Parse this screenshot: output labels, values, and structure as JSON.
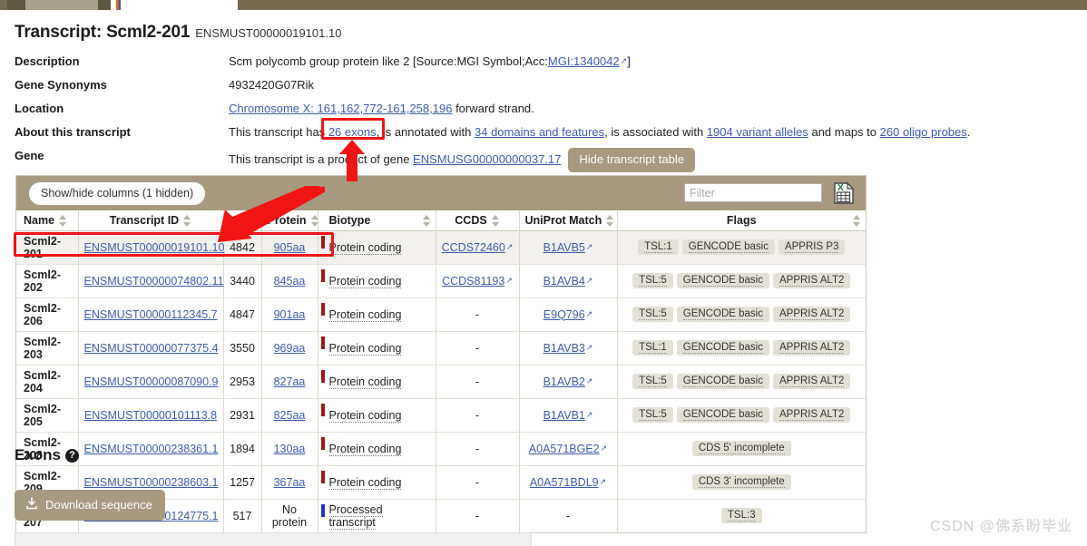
{
  "page": {
    "title_prefix": "Transcript: Scml2-201",
    "accession": "ENSMUST00000019101.10"
  },
  "summary": {
    "rows": [
      {
        "label": "Description",
        "value": "Scm polycomb group protein like 2 [Source:MGI Symbol;Acc:",
        "link": "MGI:1340042",
        "suffix": "]"
      },
      {
        "label": "Gene Synonyms",
        "value": "4932420G07Rik"
      },
      {
        "label": "Location",
        "location_link": "Chromosome X: 161,162,772-161,258,196",
        "location_suffix": " forward strand."
      },
      {
        "label": "About this transcript",
        "t1": "This transcript has ",
        "exons_link": "26 exons",
        "t2": ", is annotated with ",
        "domains_link": "34 domains and features",
        "t3": ", is associated with ",
        "alleles_link": "1904 variant alleles",
        "t4": " and maps to ",
        "probes_link": "260 oligo probes",
        "t5": "."
      },
      {
        "label": "Gene",
        "g1": "This transcript is a product of gene ",
        "gene_link": "ENSMUSG00000000037.17",
        "hide_button": "Hide transcript table"
      }
    ]
  },
  "transcript_table": {
    "show_hide_columns": "Show/hide columns (1 hidden)",
    "filter_placeholder": "Filter",
    "filter_value": "",
    "export_icon": "excel-export-icon",
    "columns": [
      "Name",
      "Transcript ID",
      "bp",
      "Protein",
      "Biotype",
      "CCDS",
      "UniProt Match",
      "Flags"
    ],
    "rows": [
      {
        "name": "Scml2-201",
        "transcript_id": "ENSMUST00000019101.10",
        "bp": "4842",
        "protein": "905aa",
        "biotype": "Protein coding",
        "biotype_color": "#9e1818",
        "ccds": "CCDS72460",
        "ccds_link": true,
        "uniprot": "B1AVB5",
        "uniprot_link": true,
        "flags": [
          "TSL:1",
          "GENCODE basic",
          "APPRIS P3"
        ],
        "highlighted": true
      },
      {
        "name": "Scml2-202",
        "transcript_id": "ENSMUST00000074802.11",
        "bp": "3440",
        "protein": "845aa",
        "biotype": "Protein coding",
        "biotype_color": "#9e1818",
        "ccds": "CCDS81193",
        "ccds_link": true,
        "uniprot": "B1AVB4",
        "uniprot_link": true,
        "flags": [
          "TSL:5",
          "GENCODE basic",
          "APPRIS ALT2"
        ],
        "highlighted": false
      },
      {
        "name": "Scml2-206",
        "transcript_id": "ENSMUST00000112345.7",
        "bp": "4847",
        "protein": "901aa",
        "biotype": "Protein coding",
        "biotype_color": "#9e1818",
        "ccds": "-",
        "ccds_link": false,
        "uniprot": "E9Q796",
        "uniprot_link": true,
        "flags": [
          "TSL:5",
          "GENCODE basic",
          "APPRIS ALT2"
        ],
        "highlighted": false
      },
      {
        "name": "Scml2-203",
        "transcript_id": "ENSMUST00000077375.4",
        "bp": "3550",
        "protein": "969aa",
        "biotype": "Protein coding",
        "biotype_color": "#9e1818",
        "ccds": "-",
        "ccds_link": false,
        "uniprot": "B1AVB3",
        "uniprot_link": true,
        "flags": [
          "TSL:1",
          "GENCODE basic",
          "APPRIS ALT2"
        ],
        "highlighted": false
      },
      {
        "name": "Scml2-204",
        "transcript_id": "ENSMUST00000087090.9",
        "bp": "2953",
        "protein": "827aa",
        "biotype": "Protein coding",
        "biotype_color": "#9e1818",
        "ccds": "-",
        "ccds_link": false,
        "uniprot": "B1AVB2",
        "uniprot_link": true,
        "flags": [
          "TSL:5",
          "GENCODE basic",
          "APPRIS ALT2"
        ],
        "highlighted": false
      },
      {
        "name": "Scml2-205",
        "transcript_id": "ENSMUST00000101113.8",
        "bp": "2931",
        "protein": "825aa",
        "biotype": "Protein coding",
        "biotype_color": "#9e1818",
        "ccds": "-",
        "ccds_link": false,
        "uniprot": "B1AVB1",
        "uniprot_link": true,
        "flags": [
          "TSL:5",
          "GENCODE basic",
          "APPRIS ALT2"
        ],
        "highlighted": false
      },
      {
        "name": "Scml2-208",
        "transcript_id": "ENSMUST00000238361.1",
        "bp": "1894",
        "protein": "130aa",
        "biotype": "Protein coding",
        "biotype_color": "#9e1818",
        "ccds": "-",
        "ccds_link": false,
        "uniprot": "A0A571BGE2",
        "uniprot_link": true,
        "flags": [
          "CDS 5' incomplete"
        ],
        "highlighted": false
      },
      {
        "name": "Scml2-209",
        "transcript_id": "ENSMUST00000238603.1",
        "bp": "1257",
        "protein": "367aa",
        "biotype": "Protein coding",
        "biotype_color": "#9e1818",
        "ccds": "-",
        "ccds_link": false,
        "uniprot": "A0A571BDL9",
        "uniprot_link": true,
        "flags": [
          "CDS 3' incomplete"
        ],
        "highlighted": false
      },
      {
        "name": "Scml2-207",
        "transcript_id": "ENSMUST00000124775.1",
        "bp": "517",
        "protein": "No protein",
        "protein_link": false,
        "biotype": "Processed transcript",
        "biotype_color": "#2233cc",
        "ccds": "-",
        "ccds_link": false,
        "uniprot": "-",
        "uniprot_link": false,
        "flags": [
          "TSL:3"
        ],
        "highlighted": false
      }
    ]
  },
  "exons_section": {
    "heading": "Exons",
    "help_icon": "question-mark-icon",
    "download_label": "Download sequence",
    "download_icon": "download-icon"
  },
  "watermark": "CSDN @佛系盼毕业",
  "colors": {
    "tan": "#a79a7f",
    "dark_olive": "#756c52",
    "link": "#3b5ca8",
    "annotation_red": "#f01414",
    "highlight_row": "#f3f1ed",
    "chip": "#e3e0d6"
  }
}
